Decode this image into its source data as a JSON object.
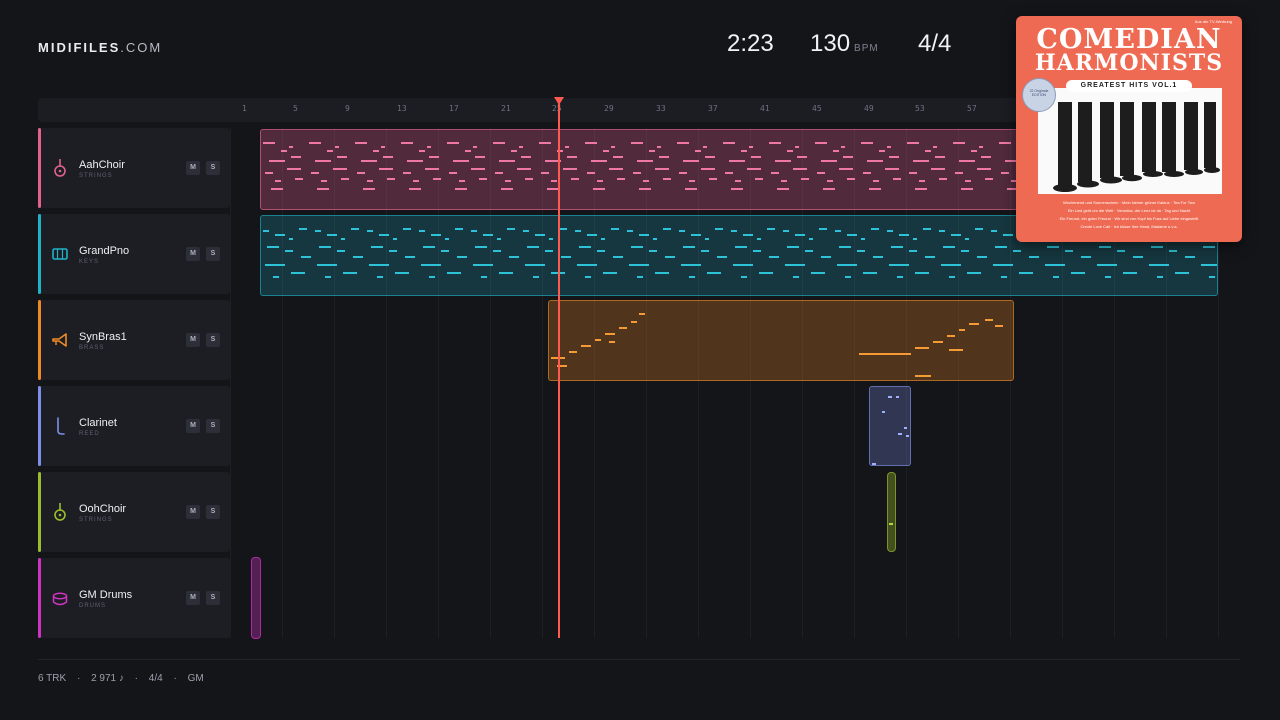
{
  "logo": {
    "brand": "MIDIFILES",
    "domain": ".COM"
  },
  "hud": {
    "time": "2:23",
    "tempo": "130",
    "tempo_unit": "BPM",
    "meter": "4/4"
  },
  "ruler": [
    "1",
    "5",
    "9",
    "13",
    "17",
    "21",
    "25",
    "29",
    "33",
    "37",
    "41",
    "45",
    "49",
    "53",
    "57"
  ],
  "tracks": [
    {
      "name": "AahChoir",
      "category": "STRINGS",
      "color": "#e2618d",
      "icon": "lute-icon"
    },
    {
      "name": "GrandPno",
      "category": "KEYS",
      "color": "#1fb3c9",
      "icon": "piano-icon"
    },
    {
      "name": "SynBras1",
      "category": "BRASS",
      "color": "#ee8a24",
      "icon": "trumpet-icon"
    },
    {
      "name": "Clarinet",
      "category": "REED",
      "color": "#7d8fe6",
      "icon": "clarinet-icon"
    },
    {
      "name": "OohChoir",
      "category": "STRINGS",
      "color": "#9bbd2c",
      "icon": "lute-icon"
    },
    {
      "name": "GM Drums",
      "category": "DRUMS",
      "color": "#cf33c2",
      "icon": "drum-icon"
    }
  ],
  "buttons": {
    "mute": "M",
    "solo": "S"
  },
  "cover": {
    "kicker": "Aus der TV-Werbung",
    "title_line1": "COMEDIAN",
    "title_line2": "HARMONISTS",
    "subtitle": "GREATEST HITS VOL.1",
    "sticker": "22 Originale EDITION",
    "songs_1": "Wochenend und Sonnenschein · Mein kleiner grüner Kaktus · Tea For Two",
    "songs_2": "Ein Lied geht um die Welt · Veronika, der Lenz ist da · Tag und Nacht",
    "songs_3": "Ein Freund, ein guter Freund · Wir sind von Kopf bis Fuss auf Liebe eingestellt",
    "songs_4": "Creole Love Call · Ich küsse Ihre Hand, Madame u.v.a."
  },
  "footer": {
    "tracks": "6 TRK",
    "notes": "2 971 ♪",
    "meter": "4/4",
    "standard": "GM",
    "sep": "·"
  }
}
